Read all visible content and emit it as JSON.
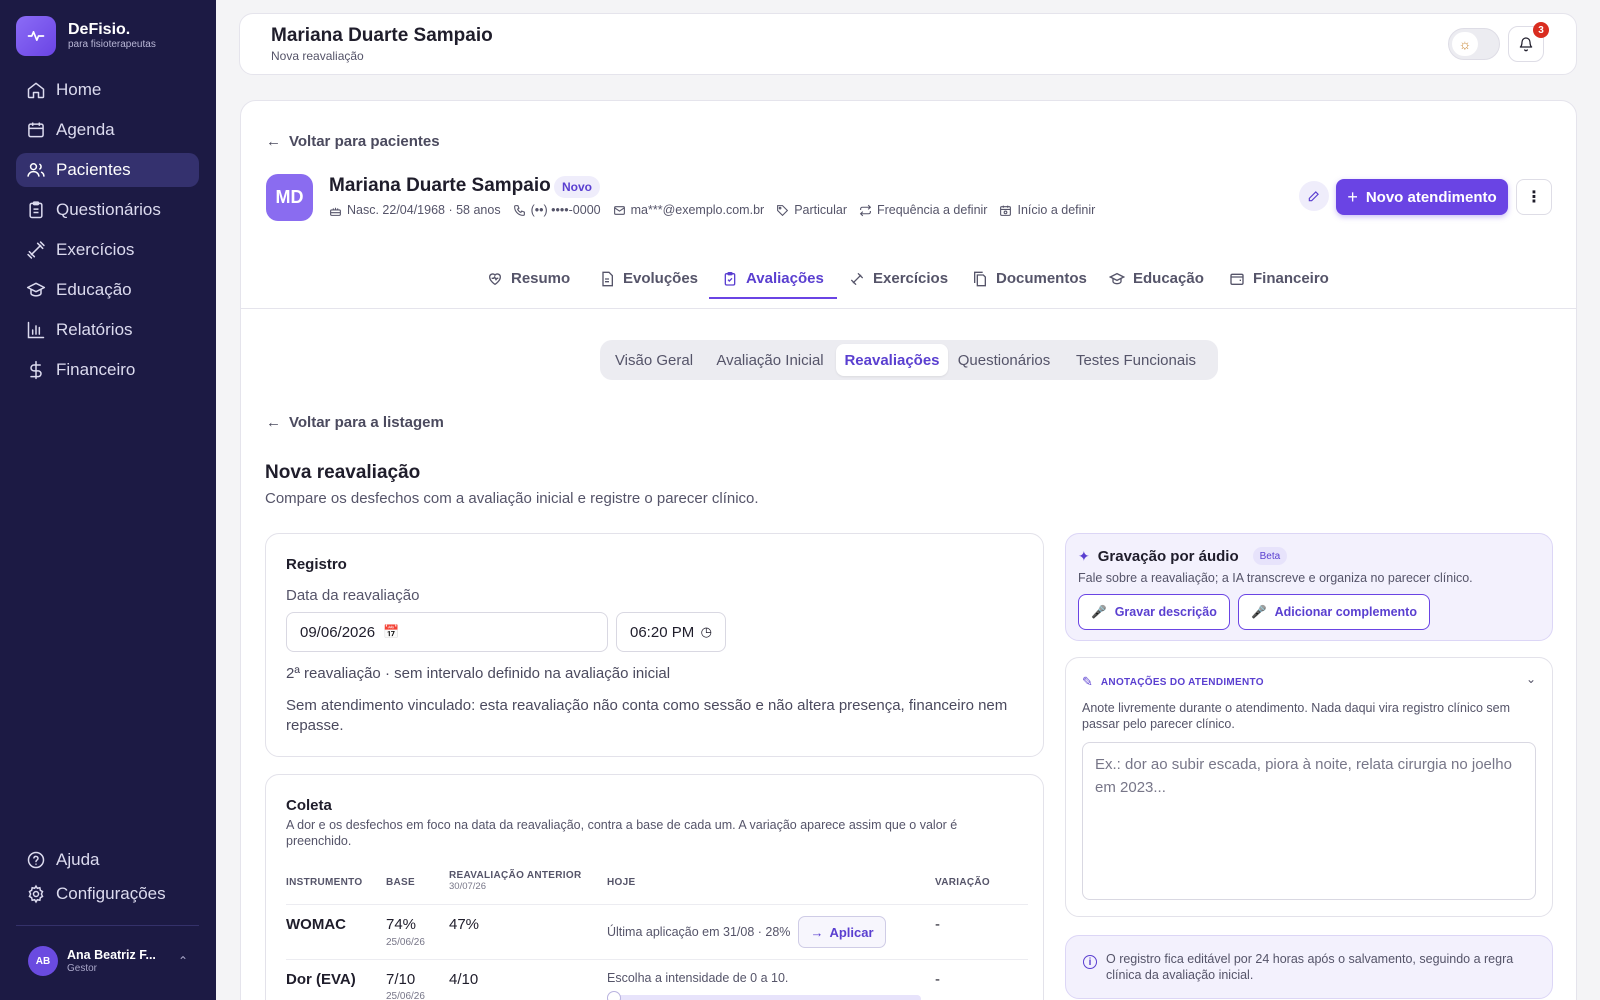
{
  "brand": {
    "name": "DeFisio.",
    "tagline": "para fisioterapeutas"
  },
  "sidebar": {
    "items": [
      {
        "label": "Home",
        "icon": "home-icon"
      },
      {
        "label": "Agenda",
        "icon": "calendar-icon"
      },
      {
        "label": "Pacientes",
        "icon": "users-icon",
        "active": true
      },
      {
        "label": "Questionários",
        "icon": "clipboard-icon"
      },
      {
        "label": "Exercícios",
        "icon": "dumbbell-icon"
      },
      {
        "label": "Educação",
        "icon": "graduation-cap-icon"
      },
      {
        "label": "Relatórios",
        "icon": "bar-chart-icon"
      },
      {
        "label": "Financeiro",
        "icon": "dollar-icon"
      }
    ],
    "bottom": [
      {
        "label": "Ajuda",
        "icon": "help-circle-icon"
      },
      {
        "label": "Configurações",
        "icon": "gear-icon"
      }
    ],
    "user": {
      "initials": "AB",
      "name": "Ana Beatriz F...",
      "role": "Gestor"
    }
  },
  "header": {
    "title": "Mariana Duarte Sampaio",
    "subtitle": "Nova reavaliação",
    "notification_count": "3"
  },
  "patient": {
    "back_label": "Voltar para pacientes",
    "initials": "MD",
    "name": "Mariana Duarte Sampaio",
    "status": "Novo",
    "birth": "Nasc. 22/04/1968 · 58 anos",
    "phone": "(••) ••••-0000",
    "email": "ma***@exemplo.com.br",
    "plan": "Particular",
    "frequency": "Frequência a definir",
    "start": "Início a definir",
    "new_button": "Novo atendimento"
  },
  "tabs": [
    {
      "label": "Resumo",
      "icon": "heart-pulse-icon"
    },
    {
      "label": "Evoluções",
      "icon": "file-text-icon"
    },
    {
      "label": "Avaliações",
      "icon": "clipboard-check-icon",
      "active": true
    },
    {
      "label": "Exercícios",
      "icon": "dumbbell-icon"
    },
    {
      "label": "Documentos",
      "icon": "files-icon"
    },
    {
      "label": "Educação",
      "icon": "graduation-cap-icon"
    },
    {
      "label": "Financeiro",
      "icon": "wallet-icon"
    }
  ],
  "subtabs": [
    "Visão Geral",
    "Avaliação Inicial",
    "Reavaliações",
    "Questionários",
    "Testes Funcionais"
  ],
  "subtab_active": "Reavaliações",
  "page": {
    "back_label": "Voltar para a listagem",
    "title": "Nova reavaliação",
    "subtitle": "Compare os desfechos com a avaliação inicial e registre o parecer clínico."
  },
  "registro": {
    "title": "Registro",
    "date_label": "Data da reavaliação",
    "date_value": "09/06/2026",
    "time_value": "06:20 PM",
    "info": "2ª reavaliação · sem intervalo definido na avaliação inicial",
    "note": "Sem atendimento vinculado: esta reavaliação não conta como sessão e não altera presença, financeiro nem repasse."
  },
  "coleta": {
    "title": "Coleta",
    "description": "A dor e os desfechos em foco na data da reavaliação, contra a base de cada um. A variação aparece assim que o valor é preenchido.",
    "headers": {
      "instrument": "INSTRUMENTO",
      "base": "BASE",
      "previous": "REAVALIAÇÃO ANTERIOR",
      "previous_date": "30/07/26",
      "today": "HOJE",
      "variation": "VARIAÇÃO"
    },
    "rows": [
      {
        "name": "WOMAC",
        "base": "74%",
        "base_date": "25/06/26",
        "previous": "47%",
        "today": "Última aplicação em 31/08 · 28%",
        "action": "Aplicar",
        "variation": "-"
      },
      {
        "name": "Dor (EVA)",
        "base": "7/10",
        "base_date": "25/06/26",
        "previous": "4/10",
        "today": "Escolha a intensidade de 0 a 10.",
        "variation": "-"
      }
    ],
    "pain_value": 0
  },
  "audio": {
    "title": "Gravação por áudio",
    "badge": "Beta",
    "description": "Fale sobre a reavaliação; a IA transcreve e organiza no parecer clínico.",
    "record_button": "Gravar descrição",
    "add_button": "Adicionar complemento"
  },
  "notes": {
    "title": "ANOTAÇÕES DO ATENDIMENTO",
    "description": "Anote livremente durante o atendimento. Nada daqui vira registro clínico sem passar pelo parecer clínico.",
    "placeholder": "Ex.: dor ao subir escada, piora à noite, relata cirurgia no joelho em 2023..."
  },
  "info_box": "O registro fica editável por 24 horas após o salvamento, seguindo a regra clínica da avaliação inicial.",
  "colors": {
    "sidebar": "#1c1a44",
    "accent": "#6a44e4",
    "accent_text": "#5a3fd0"
  }
}
